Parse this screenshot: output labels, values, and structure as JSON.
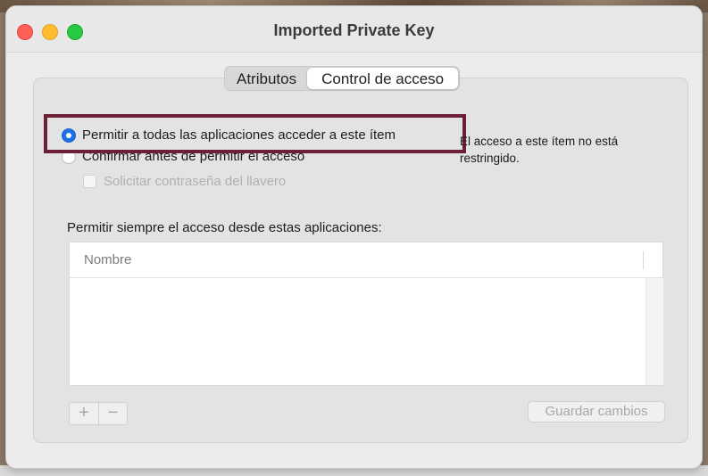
{
  "window": {
    "title": "Imported Private Key"
  },
  "tabs": [
    {
      "label": "Atributos",
      "active": false
    },
    {
      "label": "Control de acceso",
      "active": true
    }
  ],
  "access": {
    "option_all_label": "Permitir a todas las aplicaciones acceder a este ítem",
    "option_all_selected": true,
    "option_confirm_label": "Confirmar antes de permitir el acceso",
    "option_confirm_selected": false,
    "keychain_password_label": "Solicitar contraseña del llavero",
    "keychain_password_checked": false,
    "note": "El acceso a este ítem no está restringido."
  },
  "apps": {
    "section_label": "Permitir siempre el acceso desde estas aplicaciones:",
    "column_header": "Nombre",
    "rows": []
  },
  "buttons": {
    "add": "+",
    "remove": "−",
    "save": "Guardar cambios"
  },
  "colors": {
    "accent": "#1f6fe5",
    "highlight_border": "#6d1f36"
  }
}
